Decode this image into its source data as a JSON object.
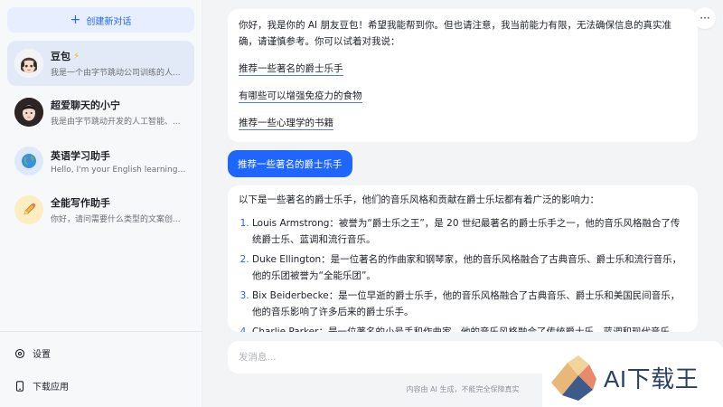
{
  "sidebar": {
    "new_chat_label": "创建新对话",
    "chats": [
      {
        "title": "豆包",
        "subtitle": "我是一个由字节跳动公司训练的人...",
        "active": true
      },
      {
        "title": "超爱聊天的小宁",
        "subtitle": "我是由字节跳动开发的人工智能、...",
        "active": false
      },
      {
        "title": "英语学习助手",
        "subtitle": "Hello, I'm your English learning a...",
        "active": false
      },
      {
        "title": "全能写作助手",
        "subtitle": "你好，请问需要什么类型的文案创...",
        "active": false
      }
    ],
    "settings_label": "设置",
    "download_label": "下载应用"
  },
  "main": {
    "more_label": "···",
    "intro_text": "你好，我是你的 AI 朋友豆包！希望我能帮到你。但也请注意，我当前能力有限，无法确保信息的真实准确，请谨慎参考。你可以试着对我说：",
    "suggestions": [
      "推荐一些著名的爵士乐手",
      "有哪些可以增强免疫力的食物",
      "推荐一些心理学的书籍"
    ],
    "user_message": "推荐一些著名的爵士乐手",
    "answer_intro": "以下是一些著名的爵士乐手，他们的音乐风格和贡献在爵士乐坛都有着广泛的影响力：",
    "answer_items": [
      "Louis Armstrong：被誉为“爵士乐之王”，是 20 世纪最著名的爵士乐手之一，他的音乐风格融合了传统爵士乐、蓝调和流行音乐。",
      "Duke Ellington：是一位著名的作曲家和钢琴家，他的音乐风格融合了古典音乐、爵士乐和流行音乐，他的乐团被誉为“全能乐团”。",
      "Bix Beiderbecke：是一位早逝的爵士乐手，他的音乐风格融合了古典音乐、爵士乐和美国民间音乐，他的音乐影响了许多后来的爵士乐手。",
      "Charlie Parker：是一位著名的小号手和作曲家，他的音乐风格融合了传统爵士乐、蓝调和现代音乐。"
    ],
    "input_placeholder": "发消息...",
    "disclaimer": "内容由 AI 生成，不能完全保障真实"
  },
  "watermark": {
    "text": "AI下载王"
  },
  "colors": {
    "accent": "#1f66ff",
    "sidebar_bg": "#f7f8fa",
    "active_item": "#e3eaf7",
    "main_bg": "#f3f4f6"
  }
}
